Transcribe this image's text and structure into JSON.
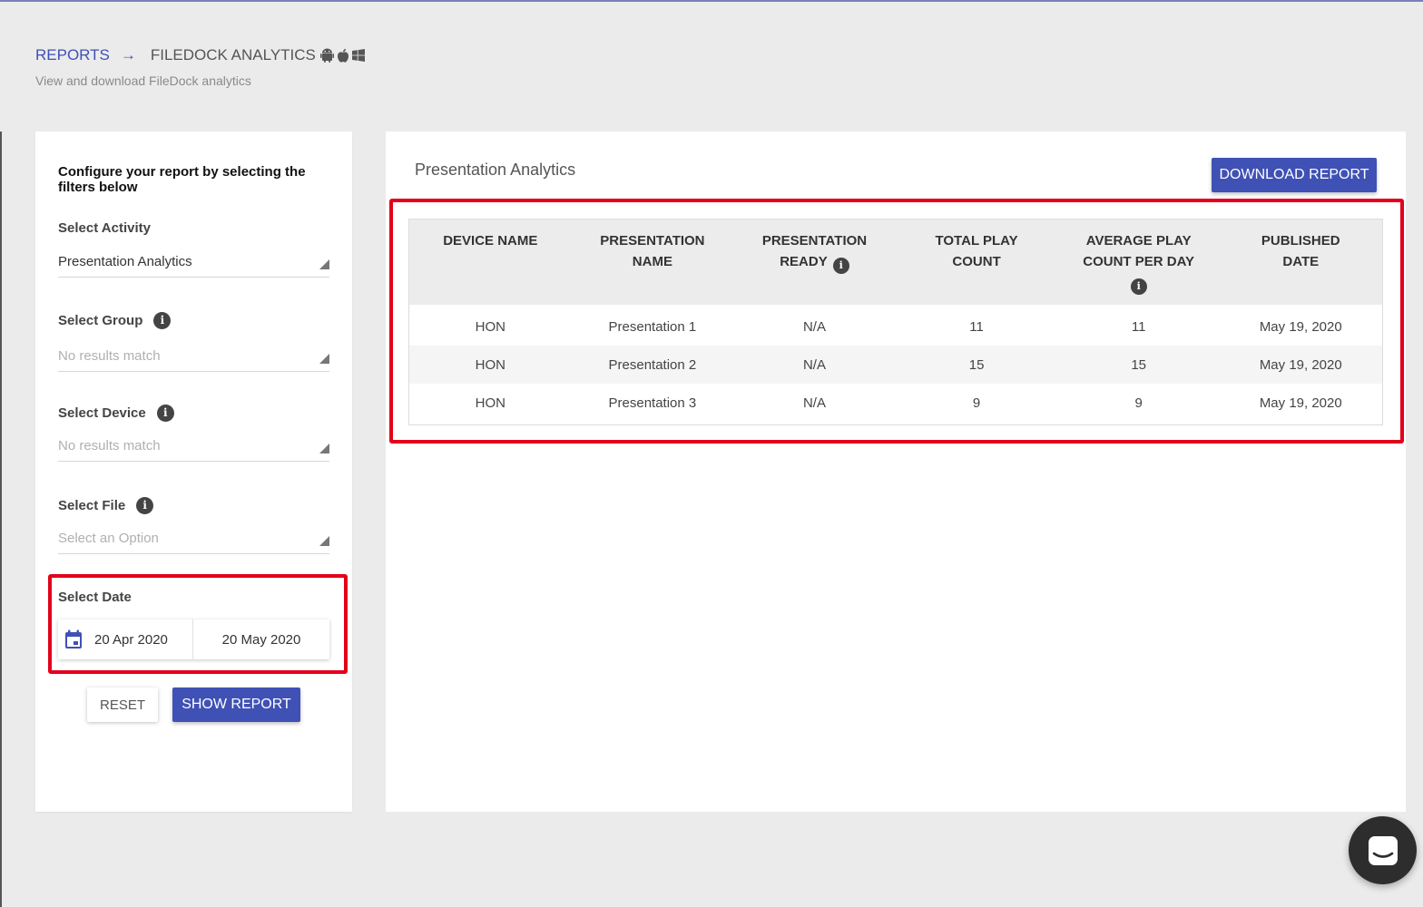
{
  "breadcrumb": {
    "root": "REPORTS",
    "arrow": "→",
    "current": "FILEDOCK ANALYTICS",
    "os_icons": [
      "android-icon",
      "apple-icon",
      "windows-icon"
    ]
  },
  "subtitle": "View and download FileDock analytics",
  "filters": {
    "intro": "Configure your report by selecting the filters below",
    "activity": {
      "label": "Select Activity",
      "value": "Presentation Analytics"
    },
    "group": {
      "label": "Select Group",
      "placeholder": "No results match"
    },
    "device": {
      "label": "Select Device",
      "placeholder": "No results match"
    },
    "file": {
      "label": "Select File",
      "placeholder": "Select an Option"
    },
    "date": {
      "label": "Select Date",
      "start": "20 Apr 2020",
      "end": "20 May 2020"
    },
    "reset_label": "RESET",
    "show_label": "SHOW REPORT"
  },
  "report": {
    "title": "Presentation Analytics",
    "download_label": "DOWNLOAD REPORT",
    "columns": {
      "device_name": "DEVICE NAME",
      "presentation_name": "PRESENTATION NAME",
      "presentation_ready": "PRESENTATION READY",
      "total_play_count": "TOTAL PLAY COUNT",
      "avg_play_count": "AVERAGE PLAY COUNT PER DAY",
      "published_date": "PUBLISHED DATE"
    },
    "rows": [
      {
        "device": "HON",
        "presentation": "Presentation 1",
        "ready": "N/A",
        "total": "11",
        "average": "11",
        "published": "May 19, 2020"
      },
      {
        "device": "HON",
        "presentation": "Presentation 2",
        "ready": "N/A",
        "total": "15",
        "average": "15",
        "published": "May 19, 2020"
      },
      {
        "device": "HON",
        "presentation": "Presentation 3",
        "ready": "N/A",
        "total": "9",
        "average": "9",
        "published": "May 19, 2020"
      }
    ]
  },
  "colors": {
    "accent": "#3f51b5",
    "highlight": "#e3001b",
    "background": "#ebebeb"
  }
}
